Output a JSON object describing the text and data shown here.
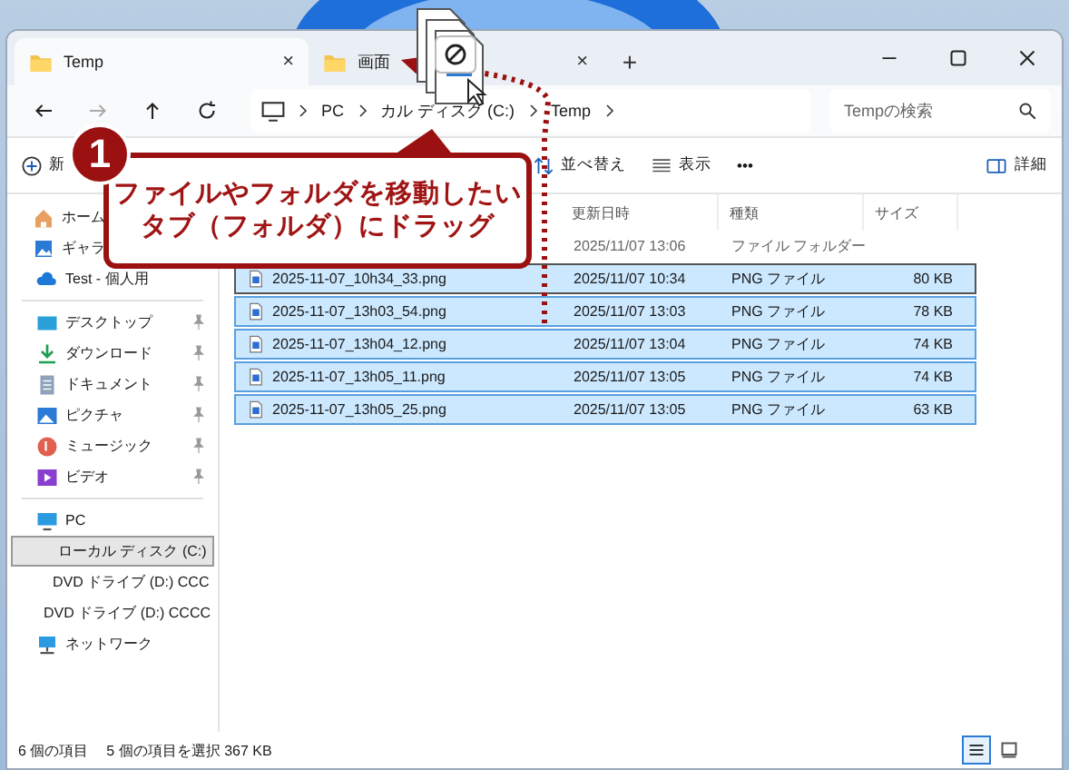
{
  "tabs": [
    {
      "label": "Temp",
      "close": "×",
      "selected": true
    },
    {
      "label": "画面",
      "close": "×",
      "selected": false
    }
  ],
  "new_tab": "+",
  "address": {
    "crumbs": [
      "PC",
      "カル ディスク (C:)",
      "Temp"
    ]
  },
  "search": {
    "placeholder": "Tempの検索"
  },
  "toolbar": {
    "new": "新",
    "sort": "並べ替え",
    "view": "表示",
    "more": "•••",
    "details": "詳細"
  },
  "sidebar": {
    "groups": [
      [
        {
          "label": "ホーム"
        },
        {
          "label": "ギャラ"
        },
        {
          "label": "Test - 個人用"
        }
      ],
      [
        {
          "label": "デスクトップ",
          "pinned": true
        },
        {
          "label": "ダウンロード",
          "pinned": true
        },
        {
          "label": "ドキュメント",
          "pinned": true
        },
        {
          "label": "ピクチャ",
          "pinned": true
        },
        {
          "label": "ミュージック",
          "pinned": true
        },
        {
          "label": "ビデオ",
          "pinned": true
        }
      ],
      [
        {
          "label": "PC",
          "selected": false,
          "children": [
            {
              "label": "ローカル ディスク (C:)",
              "selected": true
            },
            {
              "label": "DVD ドライブ (D:) CCC",
              "selected": false
            }
          ]
        },
        {
          "label": "DVD ドライブ (D:) CCCC",
          "selected": false
        },
        {
          "label": "ネットワーク",
          "selected": false
        }
      ]
    ]
  },
  "table": {
    "columns": [
      "更新日時",
      "種類",
      "サイズ"
    ],
    "rows": [
      {
        "kind": "folder",
        "date": "2025/11/07 13:06",
        "type": "ファイル フォルダー",
        "selected": false
      },
      {
        "kind": "file",
        "name": "2025-11-07_10h34_33.png",
        "date": "2025/11/07 10:34",
        "type": "PNG ファイル",
        "size": "80 KB",
        "selected": true
      },
      {
        "kind": "file",
        "name": "2025-11-07_13h03_54.png",
        "date": "2025/11/07 13:03",
        "type": "PNG ファイル",
        "size": "78 KB",
        "selected": true
      },
      {
        "kind": "file",
        "name": "2025-11-07_13h04_12.png",
        "date": "2025/11/07 13:04",
        "type": "PNG ファイル",
        "size": "74 KB",
        "selected": true
      },
      {
        "kind": "file",
        "name": "2025-11-07_13h05_11.png",
        "date": "2025/11/07 13:05",
        "type": "PNG ファイル",
        "size": "74 KB",
        "selected": true
      },
      {
        "kind": "file",
        "name": "2025-11-07_13h05_25.png",
        "date": "2025/11/07 13:05",
        "type": "PNG ファイル",
        "size": "63 KB",
        "selected": true
      }
    ]
  },
  "status_bar": {
    "count": "6 個の項目",
    "selection": "5 個の項目を選択  367 KB",
    "views": [
      {
        "kind": "details",
        "selected": true
      },
      {
        "kind": "tiles",
        "selected": false
      }
    ]
  },
  "callout": {
    "number": "1",
    "lines": [
      "ファイルやフォルダを移動したい",
      "タブ（フォルダ）にドラッグ"
    ]
  }
}
